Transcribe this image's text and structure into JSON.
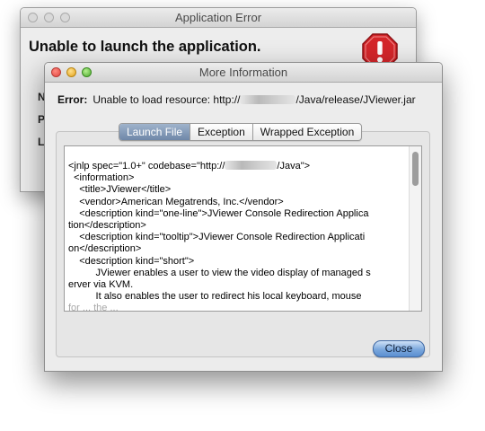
{
  "back_window": {
    "title": "Application Error",
    "heading": "Unable to launch the application.",
    "row_letters": [
      "N",
      "P",
      "L"
    ]
  },
  "front_window": {
    "title": "More Information",
    "error_label": "Error:",
    "error_text_prefix": "Unable to load resource: http://",
    "error_text_suffix": "/Java/release/JViewer.jar",
    "tabs": [
      {
        "label": "Launch File",
        "active": true
      },
      {
        "label": "Exception",
        "active": false
      },
      {
        "label": "Wrapped Exception",
        "active": false
      }
    ],
    "code_lines": {
      "l0_prefix": "<jnlp spec=\"1.0+\" codebase=\"http://",
      "l0_suffix": "/Java\">",
      "l1": "  <information>",
      "l2": "    <title>JViewer</title>",
      "l3": "    <vendor>American Megatrends, Inc.</vendor>",
      "l4": "    <description kind=\"one-line\">JViewer Console Redirection Applica",
      "l5": "tion</description>",
      "l6": "    <description kind=\"tooltip\">JViewer Console Redirection Applicati",
      "l7": "on</description>",
      "l8": "    <description kind=\"short\">",
      "l9": "          JViewer enables a user to view the video display of managed s",
      "l10": "erver via KVM.",
      "l11": "          It also enables the user to redirect his local keyboard, mouse",
      "l12": "for ... the ... "
    },
    "close_label": "Close"
  },
  "colors": {
    "accent_blue": "#6f87a8",
    "close_button": "#7aa7dc",
    "stop_red": "#d4262a"
  },
  "icons": {
    "stop": "stop-sign-exclamation-icon"
  }
}
